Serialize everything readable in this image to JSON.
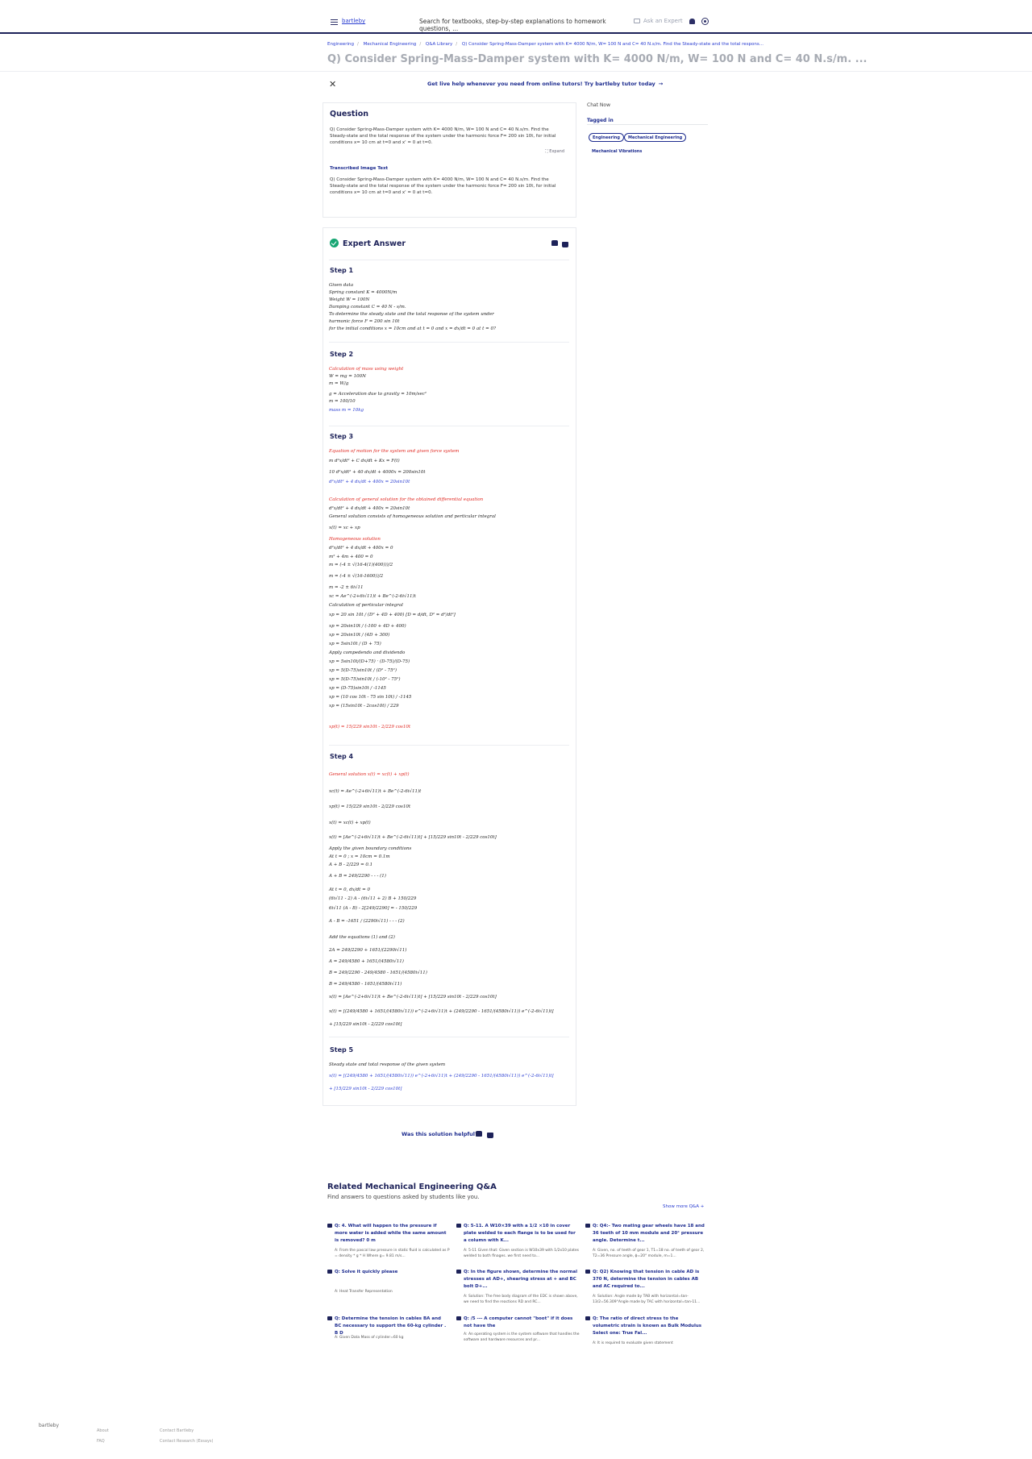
{
  "header": {
    "logo_alt": "bartleby",
    "search_placeholder": "Search for textbooks, step-by-step explanations to homework questions, ...",
    "ask_label": "Ask an Expert"
  },
  "breadcrumb": [
    "Engineering",
    "Mechanical Engineering",
    "Q&A Library",
    "Q) Consider Spring-Mass-Damper system with K= 4000 N/m, W= 100 N and C= 40 N.s/m. Find the Steady-state and the total respons..."
  ],
  "page_title": "Q) Consider Spring-Mass-Damper system with K= 4000 N/m, W= 100 N and C= 40 N.s/m. ...",
  "banner": {
    "close": "✕",
    "text": "Get live help whenever you need from online tutors!  Try bartleby tutor today",
    "arrow": "→"
  },
  "question": {
    "heading": "Question",
    "image_text": "Q) Consider Spring-Mass-Damper system with K= 4000 N/m, W= 100 N and C= 40 N.s/m. Find the Steady-state and the total response of the system under the harmonic force F= 200 sin 10t, for initial conditions x= 10 cm at t=0 and x' = 0 at t=0.",
    "expand": "Expand",
    "transcribed_heading": "Transcribed Image Text",
    "transcribed_text": "Q) Consider Spring-Mass-Damper system with K= 4000 N/m, W= 100 N and C= 40 N.s/m. Find the Steady-state and the total response of the system under the harmonic force F= 200 sin 10t, for initial conditions x= 10 cm at t=0 and x' = 0 at t=0."
  },
  "sidebar": {
    "chat": "Chat Now",
    "tagged_in": "Tagged in",
    "tags": [
      "Engineering",
      "Mechanical Engineering"
    ],
    "subtag": "Mechanical Vibrations"
  },
  "answer": {
    "heading": "Expert Answer",
    "steps": [
      {
        "title": "Step 1",
        "lines": [
          "Given data",
          "Spring constant K  =  4000N/m",
          "Weight W  =  100N",
          "Damping constant C  =  40 N - s/m.",
          "To determine the steady state and the total response of the system under",
          " harmonic force F  =  200 sin 10t",
          "for the initial conditions x  =  10cm and at t =  0 and x  =  dx/dt  =  0 at t  =  0?"
        ]
      },
      {
        "title": "Step 2",
        "lines": [
          "Calculation of mass using weight",
          "W  =  mg  =  100N",
          "m  =  W/g",
          "g  =  Acceleration due to gravity  =  10m/sec²",
          "m  =  100/10",
          "mass m  =  10kg"
        ]
      },
      {
        "title": "Step 3",
        "lines": [
          "Equation of motion for the system and given force system",
          "m d²x/dt² + C dx/dt + Kx  =  F(t)",
          "10 d²x/dt² + 40 dx/dt + 4000x  =  200sin10t",
          "d²x/dt² + 4 dx/dt + 400x  =  20sin10t",
          "Calculation of general solution for the obtained differential equation",
          "d²x/dt² + 4 dx/dt + 400x  =  20sin10t",
          "General solution consists of homogeneous solution and perticular integral",
          "x(t)  =  xc + xp",
          "Homogeneous solution",
          "d²x/dt² + 4 dx/dt + 400x  =  0",
          "m² + 4m + 400  =  0",
          "m  =  (-4 ± √(16-4(1)(400)))/2",
          "m  =  (-4 ± √(16-1600))/2",
          "m  =  -2 ± 6i√11",
          "xc  =  Ae^(-2+6i√11)t + Be^(-2-6i√11)t",
          "Calculation of perticular integral",
          "xp  =  20 sin 10t / (D² + 4D + 400)       [D = d/dt, D² = d²/dt²]",
          "xp  =  20sin10t / (-100 + 4D + 400)",
          "xp  =  20sin10t / (4D + 300)",
          "xp  =  5sin10t / (D + 75)",
          "Apply compedendo and dividendo",
          "xp  =  5sin10t/(D+75) · (D-75)/(D-75)",
          "xp  =  5(D-75)sin10t / (D² - 75²)",
          "xp  =  5(D-75)sin10t / (-10² - 75²)",
          "xp  =  (D-75)sin10t / -1145",
          "xp  =  (10 cos 10t - 75 sin 10t) / -1145",
          "xp  =  (15sin10t - 2cos10t) / 229",
          "xp(t)  =  15/229 sin10t - 2/229 cos10t"
        ]
      },
      {
        "title": "Step 4",
        "lines": [
          "General solution x(t)  =  xc(t) + xp(t)",
          "xc(t)  =  Ae^(-2+6i√11)t + Be^(-2-6i√11)t",
          "xp(t)  =  15/229 sin10t - 2/229 cos10t",
          "x(t)  =  xc(t) + xp(t)",
          "x(t)  =  [Ae^(-2+6i√11)t + Be^(-2-6i√11)t] + [15/229 sin10t - 2/229 cos10t]",
          "Apply the given boundary conditions",
          "At t  =  0 ; x  =  10cm  =  0.1m",
          "A + B - 2/229  =  0.1",
          "A + B  =  249/2290 - - - (1)",
          "At t  =  0,  dx/dt  =  0",
          "(6i√11 - 2) A - (6i√11 + 2) B + 150/229",
          "6i√11 (A - B) - 2[249/2290]  =  - 150/229",
          "A - B  =  -1651 / (2290i√11) - - - (2)",
          "Add the equations (1) and (2)",
          "2A  =  249/2290 + 1651/(2290i√11)",
          "A  =  249/4580 + 1651/(4580i√11)",
          "B  =  249/2290 - 249/4580 - 1651/(4580i√11)",
          "B  =  249/4580 - 1651/(4580i√11)",
          "x(t)  =  [Ae^(-2+6i√11)t + Be^(-2-6i√11)t] + [15/229 sin10t - 2/229 cos10t]",
          "x(t)  =  [(249/4580 + 1651/(4580i√11)) e^(-2+6i√11)t + (249/2290 - 1651/(4580i√11)) e^(-2-6i√11)t]",
          "+ [15/229 sin10t - 2/229 cos10t]"
        ]
      },
      {
        "title": "Step 5",
        "lines": [
          "Steady state and total response of the given system",
          "x(t)  =  [(249/4580 + 1651/(4580i√11)) e^(-2+6i√11)t + (249/2290 - 1651/(4580i√11)) e^(-2-6i√11)t]",
          "+ [15/229 sin10t - 2/229 cos10t]"
        ]
      }
    ],
    "helpful": "Was this solution helpful?"
  },
  "related": {
    "title": "Related Mechanical Engineering Q&A",
    "subtitle": "Find answers to questions asked by students like you.",
    "show_more": "Show more Q&A  +",
    "items": [
      {
        "q": "Q: 4. What will happen to the pressure if more water is added while the same amount is removed? 0 m",
        "a": "A: From the pascal law pressure in static fluid is calculated as P = density * g * H  Where g= 9.81 m/s..."
      },
      {
        "q": "Q: 5-11. A W10×39 with a 1/2 ×10 in cover plate welded to each flange is to be used for a column with K...",
        "a": "A: 5-11 Given that: Given section is W10x39 with 1/2x10 plates welded to both flnages. we first need to..."
      },
      {
        "q": "Q: Q4:- Two mating gear wheels have 18 and 36 teeth of 10 mm module and 20° pressure angle. Determine t...",
        "a": "A: Given, no. of teeth of gear 1, T1=18 no. of teeth of gear 2, T2=36 Pressure angle, ɸ=20° module, m=1..."
      },
      {
        "q": "Q: Solve it quickly please",
        "a": "A: Heat Transfer Representation"
      },
      {
        "q": "Q: In the figure shown, determine the normal stresses at AD+, shearing stress at + and BC bolt D+...",
        "a": "A: Solution: The free body diagram of the EDC is shown above, we need to find the reactions RD and RC..."
      },
      {
        "q": "Q: Q2) Knowing that tension in cable AD is 370 N, determine the tension in cables AB and AC required to...",
        "a": "A: Solution: Angle made by TAB with horizontal=tan-13/2=56.309°Angle made by TAC with horizontal=tan-11..."
      },
      {
        "q": "Q: Determine the tension in cables BA and BC necessary to support the 60-kg cylinder . B D",
        "a": "A: Given Data Mass of cylinder=60 kg"
      },
      {
        "q": "Q: /5 --- A computer cannot \"boot\" if it does not have the",
        "a": "A:   An operating system is the system software that handles the software and hardware resources and pr..."
      },
      {
        "q": "Q: The ratio of direct stress to the volumetric strain is known as Bulk Modulus Select one: True Fal...",
        "a": "A: It is required to evaluate given statement"
      }
    ]
  },
  "footer": {
    "logo_alt": "bartleby",
    "links": [
      "About",
      "FAQ",
      "Contact Bartleby",
      "Contact Research (Essays)"
    ]
  }
}
